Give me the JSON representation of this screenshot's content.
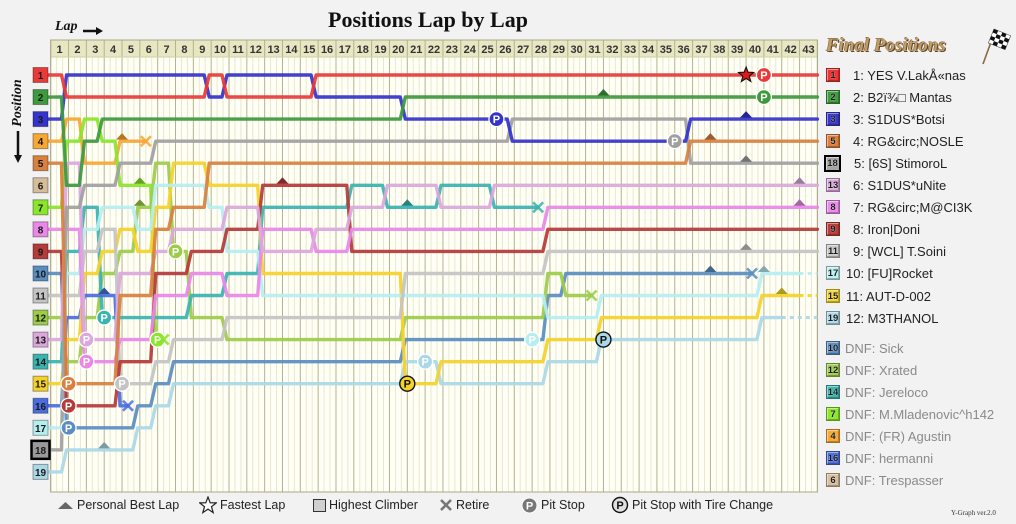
{
  "title": "Positions Lap by Lap",
  "axis": {
    "x_label": "Lap",
    "y_label": "Position"
  },
  "final_panel": {
    "title": "Final Positions"
  },
  "final_positions": [
    {
      "badge": "1",
      "text": "1: YES V.LakÅ«nas",
      "color": "#ee3434"
    },
    {
      "badge": "2",
      "text": "2: B2ï¾□ Mantas",
      "color": "#3f9c3f"
    },
    {
      "badge": "3",
      "text": "3: S1DUS*Botsi",
      "color": "#3838cc"
    },
    {
      "badge": "5",
      "text": "4: RG&circ;NOSLE",
      "color": "#dc7f40"
    },
    {
      "badge": "18",
      "text": "5: [6S] StimoroL",
      "color": "#a6a6a6",
      "highest_climber": true
    },
    {
      "badge": "13",
      "text": "6: S1DUS*uNite",
      "color": "#dcaadc"
    },
    {
      "badge": "8",
      "text": "7: RG&circ;M@CI3K",
      "color": "#ec8cea"
    },
    {
      "badge": "9",
      "text": "8: Iron|Doni",
      "color": "#bb3c3c"
    },
    {
      "badge": "11",
      "text": "9: [WCL] T.Soini",
      "color": "#c8c8c8"
    },
    {
      "badge": "17",
      "text": "10: [FU]Rocket",
      "color": "#bdf0f2"
    },
    {
      "badge": "15",
      "text": "11: AUT-D-002",
      "color": "#f6d42c"
    },
    {
      "badge": "19",
      "text": "12: M3THANOL",
      "color": "#aed9e7"
    }
  ],
  "dnf": [
    {
      "badge": "10",
      "text": "DNF: Sick",
      "color": "#5d90c2"
    },
    {
      "badge": "12",
      "text": "DNF: Xrated",
      "color": "#9ecd4a"
    },
    {
      "badge": "14",
      "text": "DNF: Jereloco",
      "color": "#3cb6b2"
    },
    {
      "badge": "7",
      "text": "DNF: M.Mladenovic^h142",
      "color": "#8ce82c"
    },
    {
      "badge": "4",
      "text": "DNF: (FR) Agustin",
      "color": "#f8a935"
    },
    {
      "badge": "16",
      "text": "DNF: hermanni",
      "color": "#4c70e2"
    },
    {
      "badge": "6",
      "text": "DNF: Trespasser",
      "color": "#d8be9c"
    }
  ],
  "legend": [
    {
      "icon": "triangle-up-icon",
      "label": "Personal Best Lap"
    },
    {
      "icon": "star-icon",
      "label": "Fastest Lap"
    },
    {
      "icon": "square-icon",
      "label": "Highest Climber"
    },
    {
      "icon": "cross-icon",
      "label": "Retire"
    },
    {
      "icon": "pit-stop-icon",
      "label": "Pit Stop"
    },
    {
      "icon": "pit-stop-tire-change-icon",
      "label": "Pit Stop with Tire Change"
    }
  ],
  "footer": {
    "version": "Y-Graph ver.2.0"
  },
  "chart_data": {
    "type": "line",
    "title": "Positions Lap by Lap",
    "xlabel": "Lap",
    "ylabel": "Position",
    "laps": [
      1,
      2,
      3,
      4,
      5,
      6,
      7,
      8,
      9,
      10,
      11,
      12,
      13,
      14,
      15,
      16,
      17,
      18,
      19,
      20,
      21,
      22,
      23,
      24,
      25,
      26,
      27,
      28,
      29,
      30,
      31,
      32,
      33,
      34,
      35,
      36,
      37,
      38,
      39,
      40,
      41,
      42,
      43
    ],
    "y_range": [
      1,
      19
    ],
    "y_inverted": true,
    "grid": true,
    "pit_symbol": "P",
    "series": [
      {
        "grid": 1,
        "name": "YES V.LakÅ«nas",
        "color": "#e93a3a",
        "finish": 1,
        "laps_completed": 43,
        "positions": [
          2,
          2,
          2,
          2,
          2,
          2,
          2,
          2,
          1,
          2,
          2,
          2,
          2,
          2,
          1,
          1,
          1,
          1,
          1,
          1,
          1,
          1,
          1,
          1,
          1,
          1,
          1,
          1,
          1,
          1,
          1,
          1,
          1,
          1,
          1,
          1,
          1,
          1,
          1,
          1,
          1,
          1,
          1
        ]
      },
      {
        "grid": 2,
        "name": "B2ï¾□ Mantas",
        "color": "#3d9a3d",
        "finish": 2,
        "laps_completed": 43,
        "positions": [
          6,
          4,
          3,
          3,
          3,
          3,
          3,
          3,
          3,
          3,
          3,
          3,
          3,
          3,
          3,
          3,
          3,
          3,
          3,
          2,
          2,
          2,
          2,
          2,
          2,
          2,
          2,
          2,
          2,
          2,
          2,
          2,
          2,
          2,
          2,
          2,
          2,
          2,
          2,
          2,
          2,
          2,
          2
        ]
      },
      {
        "grid": 3,
        "name": "S1DUS*Botsi",
        "color": "#3434cc",
        "finish": 3,
        "laps_completed": 43,
        "positions": [
          1,
          1,
          1,
          1,
          1,
          1,
          1,
          1,
          2,
          1,
          1,
          1,
          1,
          1,
          2,
          2,
          2,
          2,
          2,
          3,
          3,
          3,
          3,
          3,
          3,
          4,
          4,
          4,
          4,
          4,
          4,
          4,
          4,
          4,
          4,
          3,
          3,
          3,
          3,
          3,
          3,
          3,
          3
        ]
      },
      {
        "grid": 4,
        "name": "(FR) Agustin",
        "color": "#f7a733",
        "finish": null,
        "laps_completed": 5,
        "positions": [
          3,
          5,
          5,
          4,
          4
        ]
      },
      {
        "grid": 5,
        "name": "RG&circ;NOSLE",
        "color": "#d98040",
        "finish": 4,
        "laps_completed": 43,
        "positions": [
          15,
          15,
          15,
          11,
          11,
          8,
          7,
          7,
          5,
          5,
          5,
          5,
          5,
          5,
          5,
          5,
          5,
          5,
          5,
          5,
          5,
          5,
          5,
          5,
          5,
          5,
          5,
          5,
          5,
          5,
          5,
          5,
          5,
          5,
          5,
          4,
          4,
          4,
          4,
          4,
          4,
          4,
          4
        ]
      },
      {
        "grid": 6,
        "name": "Trespasser",
        "color": "#d6bc9a",
        "finish": null,
        "laps_completed": 0,
        "positions": []
      },
      {
        "grid": 7,
        "name": "M.Mladenovic^h142",
        "color": "#8ae62a",
        "finish": null,
        "laps_completed": 6,
        "positions": [
          4,
          3,
          4,
          6,
          6,
          13
        ]
      },
      {
        "grid": 8,
        "name": "RG&circ;M@CI3K",
        "color": "#ea88e8",
        "finish": 7,
        "laps_completed": 43,
        "positions": [
          8,
          14,
          14,
          13,
          13,
          11,
          11,
          10,
          10,
          11,
          11,
          8,
          8,
          8,
          9,
          9,
          8,
          8,
          8,
          8,
          8,
          8,
          8,
          8,
          8,
          8,
          8,
          7,
          7,
          7,
          7,
          7,
          7,
          7,
          7,
          7,
          7,
          7,
          7,
          7,
          7,
          7,
          7
        ]
      },
      {
        "grid": 9,
        "name": "Iron|Doni",
        "color": "#b53a3a",
        "finish": 8,
        "laps_completed": 43,
        "positions": [
          16,
          16,
          16,
          14,
          14,
          10,
          10,
          9,
          9,
          8,
          8,
          6,
          6,
          6,
          6,
          6,
          9,
          9,
          9,
          9,
          9,
          9,
          9,
          9,
          9,
          9,
          9,
          8,
          8,
          8,
          8,
          8,
          8,
          8,
          8,
          8,
          8,
          8,
          8,
          8,
          8,
          8,
          8
        ]
      },
      {
        "grid": 10,
        "name": "Sick",
        "color": "#5a8ec0",
        "finish": null,
        "laps_completed": 39,
        "positions": [
          17,
          17,
          17,
          17,
          16,
          15,
          14,
          14,
          14,
          14,
          14,
          14,
          14,
          14,
          14,
          14,
          14,
          14,
          14,
          13,
          13,
          13,
          13,
          13,
          13,
          13,
          13,
          11,
          10,
          10,
          10,
          10,
          10,
          10,
          10,
          10,
          10,
          10,
          10
        ]
      },
      {
        "grid": 11,
        "name": "[WCL] T.Soini",
        "color": "#c4c4c4",
        "finish": 9,
        "laps_completed": 43,
        "positions": [
          11,
          9,
          8,
          15,
          15,
          14,
          13,
          13,
          13,
          12,
          12,
          12,
          12,
          12,
          12,
          12,
          12,
          12,
          12,
          10,
          10,
          10,
          10,
          10,
          10,
          10,
          10,
          9,
          9,
          9,
          9,
          9,
          9,
          9,
          9,
          9,
          9,
          9,
          9,
          9,
          9,
          9,
          9
        ]
      },
      {
        "grid": 12,
        "name": "Xrated",
        "color": "#9ccc48",
        "finish": null,
        "laps_completed": 30,
        "positions": [
          14,
          12,
          10,
          9,
          7,
          5,
          9,
          12,
          12,
          13,
          13,
          13,
          13,
          13,
          13,
          13,
          13,
          13,
          13,
          12,
          12,
          12,
          12,
          12,
          12,
          12,
          12,
          10,
          11,
          11
        ]
      },
      {
        "grid": 13,
        "name": "S1DUS*uNite",
        "color": "#dca8dc",
        "finish": 6,
        "laps_completed": 43,
        "positions": [
          5,
          13,
          13,
          10,
          10,
          9,
          8,
          8,
          8,
          7,
          7,
          9,
          9,
          9,
          8,
          8,
          7,
          7,
          6,
          6,
          6,
          7,
          7,
          7,
          6,
          6,
          6,
          6,
          6,
          6,
          6,
          6,
          6,
          6,
          6,
          6,
          6,
          6,
          6,
          6,
          6,
          6,
          6
        ]
      },
      {
        "grid": 14,
        "name": "Jereloco",
        "color": "#3ab4b0",
        "finish": null,
        "laps_completed": 27,
        "positions": [
          9,
          7,
          12,
          12,
          12,
          12,
          12,
          11,
          11,
          10,
          10,
          7,
          7,
          7,
          7,
          7,
          6,
          6,
          7,
          7,
          7,
          6,
          6,
          6,
          7,
          7,
          7
        ]
      },
      {
        "grid": 15,
        "name": "AUT-D-002",
        "color": "#f5d22a",
        "finish": 11,
        "laps_completed": 42,
        "positions": [
          13,
          10,
          9,
          8,
          9,
          7,
          5,
          5,
          6,
          6,
          6,
          10,
          10,
          10,
          10,
          10,
          10,
          10,
          10,
          15,
          15,
          14,
          14,
          14,
          14,
          14,
          14,
          13,
          13,
          13,
          12,
          12,
          12,
          12,
          12,
          12,
          12,
          12,
          12,
          11,
          11,
          11,
          11
        ]
      },
      {
        "grid": 16,
        "name": "hermanni",
        "color": "#4a6ee0",
        "finish": null,
        "laps_completed": 4,
        "positions": [
          12,
          11,
          11,
          16
        ]
      },
      {
        "grid": 17,
        "name": "[FU]Rocket",
        "color": "#b6eef0",
        "finish": 10,
        "laps_completed": 42,
        "positions": [
          10,
          8,
          7,
          7,
          8,
          6,
          6,
          6,
          7,
          9,
          9,
          11,
          11,
          11,
          11,
          11,
          11,
          11,
          11,
          11,
          11,
          11,
          11,
          11,
          11,
          11,
          11,
          12,
          12,
          12,
          11,
          11,
          11,
          11,
          11,
          11,
          11,
          11,
          11,
          10,
          10,
          10,
          10
        ]
      },
      {
        "grid": 18,
        "name": "[6S] StimoroL",
        "color": "#a0a0a0",
        "finish": 5,
        "laps_completed": 43,
        "highest_climber": true,
        "positions": [
          7,
          6,
          6,
          5,
          5,
          4,
          4,
          4,
          4,
          4,
          4,
          4,
          4,
          4,
          4,
          4,
          4,
          4,
          4,
          4,
          4,
          4,
          4,
          4,
          4,
          3,
          3,
          3,
          3,
          3,
          3,
          3,
          3,
          3,
          3,
          5,
          5,
          5,
          5,
          5,
          5,
          5,
          5
        ]
      },
      {
        "grid": 19,
        "name": "M3THANOL",
        "color": "#aad8e6",
        "finish": 12,
        "laps_completed": 41,
        "positions": [
          18,
          18,
          18,
          18,
          17,
          16,
          15,
          15,
          15,
          15,
          15,
          15,
          15,
          15,
          15,
          15,
          15,
          15,
          15,
          14,
          14,
          15,
          15,
          15,
          15,
          15,
          15,
          14,
          14,
          14,
          13,
          13,
          13,
          13,
          13,
          13,
          13,
          13,
          13,
          12,
          12,
          12,
          12
        ]
      }
    ],
    "markers": [
      {
        "type": "pit",
        "grid": 5,
        "lap": 1,
        "position": 15
      },
      {
        "type": "pit",
        "grid": 9,
        "lap": 1,
        "position": 16
      },
      {
        "type": "pit",
        "grid": 10,
        "lap": 1,
        "position": 17
      },
      {
        "type": "pit",
        "grid": 13,
        "lap": 2,
        "position": 13
      },
      {
        "type": "pit",
        "grid": 8,
        "lap": 2,
        "position": 14
      },
      {
        "type": "pit",
        "grid": 14,
        "lap": 3,
        "position": 12
      },
      {
        "type": "pit",
        "grid": 11,
        "lap": 4,
        "position": 15
      },
      {
        "type": "pit",
        "grid": 7,
        "lap": 6,
        "position": 13
      },
      {
        "type": "pit",
        "grid": 12,
        "lap": 7,
        "position": 9
      },
      {
        "type": "pit_tire_change",
        "grid": 15,
        "lap": 20,
        "position": 15
      },
      {
        "type": "pit",
        "grid": 19,
        "lap": 21,
        "position": 14
      },
      {
        "type": "pit",
        "grid": 3,
        "lap": 25,
        "position": 3
      },
      {
        "type": "pit",
        "grid": 17,
        "lap": 27,
        "position": 13
      },
      {
        "type": "pit_tire_change",
        "grid": 19,
        "lap": 31,
        "position": 13
      },
      {
        "type": "pit",
        "grid": 18,
        "lap": 35,
        "position": 4
      },
      {
        "type": "pit",
        "grid": 1,
        "lap": 40,
        "position": 1
      },
      {
        "type": "pit",
        "grid": 2,
        "lap": 40,
        "position": 2
      },
      {
        "type": "fastest_lap",
        "grid": 1,
        "lap": 39,
        "position": 1
      },
      {
        "type": "best_lap",
        "grid": 16,
        "lap": 3,
        "position": 11
      },
      {
        "type": "best_lap",
        "grid": 19,
        "lap": 3,
        "position": 18
      },
      {
        "type": "best_lap",
        "grid": 4,
        "lap": 4,
        "position": 4
      },
      {
        "type": "best_lap",
        "grid": 7,
        "lap": 5,
        "position": 6
      },
      {
        "type": "best_lap",
        "grid": 12,
        "lap": 5,
        "position": 7
      },
      {
        "type": "best_lap",
        "grid": 9,
        "lap": 13,
        "position": 6
      },
      {
        "type": "best_lap",
        "grid": 14,
        "lap": 20,
        "position": 7
      },
      {
        "type": "best_lap",
        "grid": 2,
        "lap": 31,
        "position": 2
      },
      {
        "type": "best_lap",
        "grid": 5,
        "lap": 37,
        "position": 4
      },
      {
        "type": "best_lap",
        "grid": 10,
        "lap": 37,
        "position": 10
      },
      {
        "type": "best_lap",
        "grid": 3,
        "lap": 39,
        "position": 3
      },
      {
        "type": "best_lap",
        "grid": 18,
        "lap": 39,
        "position": 5
      },
      {
        "type": "best_lap",
        "grid": 11,
        "lap": 39,
        "position": 9
      },
      {
        "type": "best_lap",
        "grid": 17,
        "lap": 40,
        "position": 10
      },
      {
        "type": "best_lap",
        "grid": 15,
        "lap": 41,
        "position": 11
      },
      {
        "type": "best_lap",
        "grid": 13,
        "lap": 42,
        "position": 6
      },
      {
        "type": "best_lap",
        "grid": 8,
        "lap": 42,
        "position": 7
      },
      {
        "type": "retire",
        "grid": 16,
        "lap": 4,
        "position": 16
      },
      {
        "type": "retire",
        "grid": 4,
        "lap": 5,
        "position": 4
      },
      {
        "type": "retire",
        "grid": 7,
        "lap": 6,
        "position": 13
      },
      {
        "type": "retire",
        "grid": 14,
        "lap": 27,
        "position": 7
      },
      {
        "type": "retire",
        "grid": 12,
        "lap": 30,
        "position": 11
      },
      {
        "type": "retire",
        "grid": 10,
        "lap": 39,
        "position": 10
      }
    ]
  }
}
